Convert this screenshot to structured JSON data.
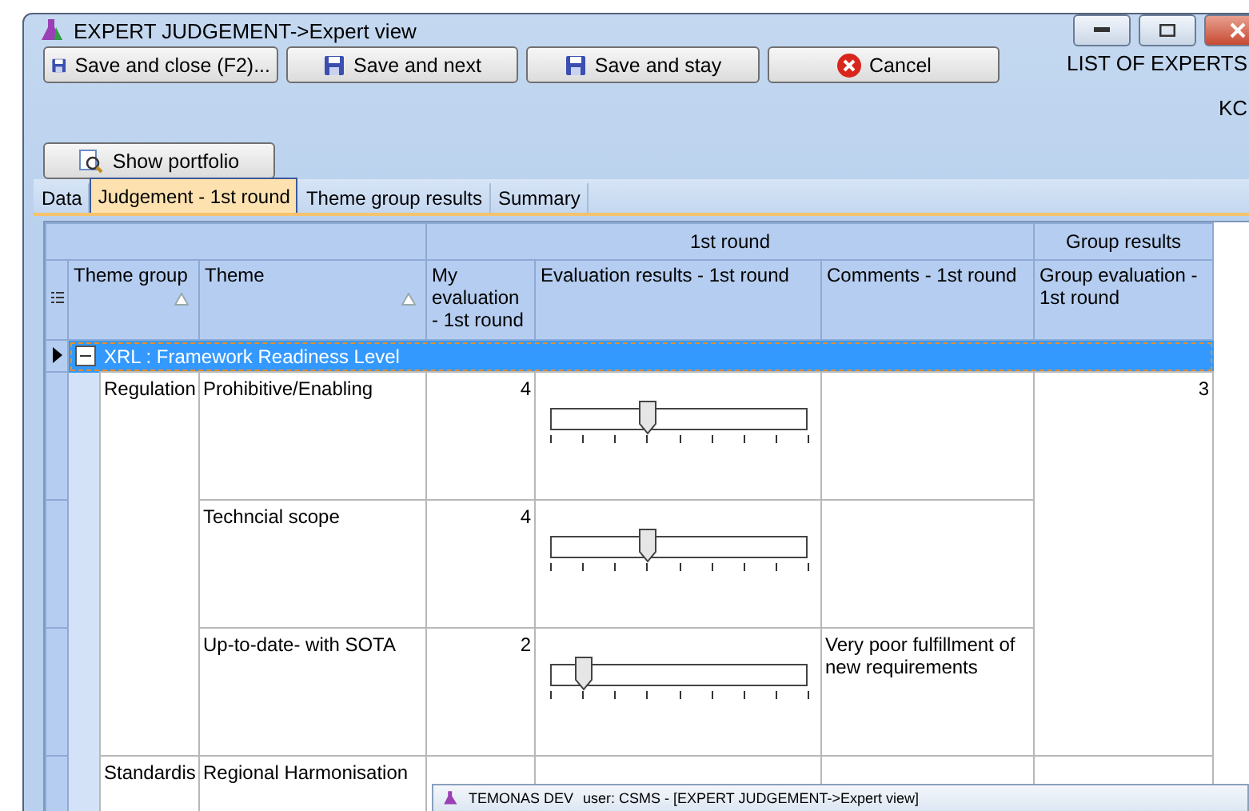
{
  "window": {
    "title": "EXPERT JUDGEMENT->Expert view"
  },
  "toolbar": [
    {
      "label": "Save and close (F2)...",
      "kind": "save"
    },
    {
      "label": "Save and next",
      "kind": "save"
    },
    {
      "label": "Save and stay",
      "kind": "save"
    },
    {
      "label": "Cancel",
      "kind": "cancel"
    }
  ],
  "header_right": [
    "LIST OF EXPERTS",
    "KC"
  ],
  "portfolio_button": "Show portfolio",
  "tabs": [
    {
      "label": "Data",
      "selected": false
    },
    {
      "label": "Judgement - 1st round",
      "selected": true
    },
    {
      "label": "Theme group results",
      "selected": false
    },
    {
      "label": "Summary",
      "selected": false
    }
  ],
  "grid": {
    "bands": [
      "1st round",
      "Group results"
    ],
    "columns": [
      "Theme group",
      "Theme",
      "My evaluation - 1st round",
      "Evaluation results - 1st round",
      "Comments - 1st round",
      "Group evaluation - 1st round"
    ],
    "group_row": {
      "label": "XRL : Framework Readiness Level",
      "expanded": true,
      "selected": true
    },
    "groups": [
      {
        "name": "Regulation",
        "group_evaluation": "3",
        "themes": [
          {
            "theme": "Prohibitive/Enabling",
            "my_evaluation": "4",
            "level": 0.375
          },
          {
            "theme": "Techncial scope",
            "my_evaluation": "4",
            "level": 0.375
          },
          {
            "theme": "Up-to-date- with SOTA",
            "my_evaluation": "2",
            "level": 0.125,
            "comment": "Very poor fulfillment of new requirements"
          }
        ]
      },
      {
        "name": "Standardis",
        "themes": [
          {
            "theme": "Regional Harmonisation"
          }
        ]
      }
    ]
  },
  "taskbar_preview": {
    "app": "TEMONAS DEV",
    "caption": "user: CSMS - [EXPERT JUDGEMENT->Expert view]"
  }
}
